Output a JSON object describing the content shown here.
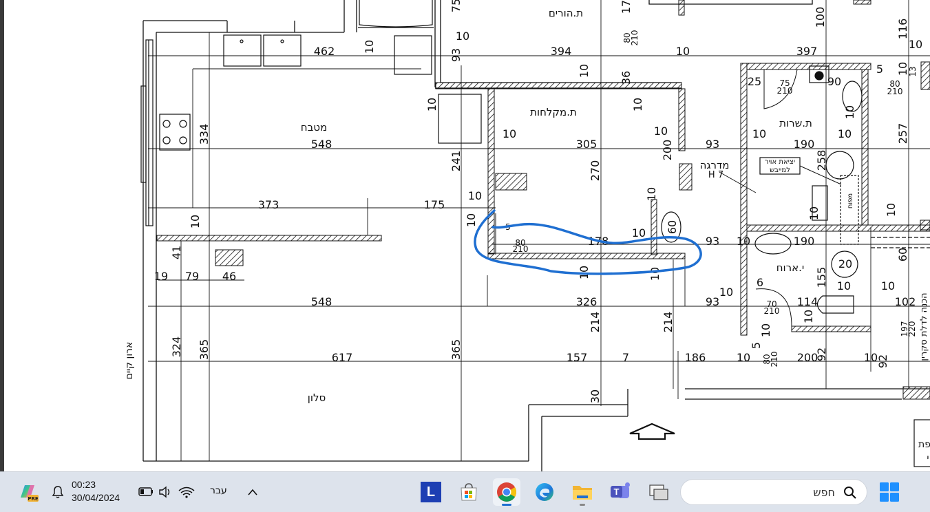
{
  "plan": {
    "rooms": {
      "kitchen": "מטבח",
      "parents_bath": "ת.הורים",
      "showers": "ת.מקלחות",
      "stairs": "מדרגה",
      "stairs_h": "H 7",
      "service_wc": "ת.שרות",
      "closet": "י.ארוח",
      "living": "סלון",
      "existing_closet": "ארון קיים",
      "exhaust_line1": "יציאת אויר",
      "exhaust_line2": "למייבש",
      "shaft": "מפוח",
      "right_note": "הכנה לדלת סקרין",
      "right_edge_text1": "פת",
      "right_edge_text2": "י"
    },
    "dimensions": {
      "d462": "462",
      "d394": "394",
      "d397": "397",
      "d548a": "548",
      "d305": "305",
      "d190a": "190",
      "d373": "373",
      "d175": "175",
      "d93a": "93",
      "d93b": "93",
      "d93c": "93",
      "d548b": "548",
      "d326": "326",
      "d617": "617",
      "d157": "157",
      "d186": "186",
      "d200": "200",
      "d178": "178",
      "d190b": "190",
      "d114": "114",
      "d102": "102",
      "d79": "79",
      "d46": "46",
      "d19": "19",
      "d334": "334",
      "d241": "241",
      "d270": "270",
      "d214a": "214",
      "d214b": "214",
      "d324": "324",
      "d365a": "365",
      "d365b": "365",
      "d41": "41",
      "d30": "30",
      "d116": "116",
      "d257": "257",
      "d100": "100",
      "d60a": "60",
      "d60b": "60",
      "d155": "155",
      "d258": "258",
      "d197": "197",
      "d220": "220",
      "d92a": "92",
      "d92b": "92",
      "d10": "10",
      "d80": "80",
      "d210": "210",
      "d75": "75",
      "d90": "90",
      "d25": "25",
      "d5": "5",
      "d70": "70",
      "d20": "20",
      "d36": "36",
      "d6": "6",
      "d7": "7",
      "d13": "13",
      "d75top": "75",
      "d17": "17"
    }
  },
  "taskbar": {
    "clock_time": "00:23",
    "clock_date": "30/04/2024",
    "language": "עבר",
    "search_placeholder": "חפש",
    "apps": [
      {
        "name": "copilot-icon"
      },
      {
        "name": "l-app-icon",
        "label": "L"
      },
      {
        "name": "microsoft-store-icon"
      },
      {
        "name": "chrome-icon"
      },
      {
        "name": "edge-icon"
      },
      {
        "name": "file-explorer-icon"
      },
      {
        "name": "teams-icon",
        "label": "T"
      },
      {
        "name": "task-view-icon"
      },
      {
        "name": "start-icon"
      }
    ]
  },
  "colors": {
    "annotation": "#1f6fd1",
    "taskbar_bg": "#dde3ec",
    "accent": "#1f6fd1"
  }
}
